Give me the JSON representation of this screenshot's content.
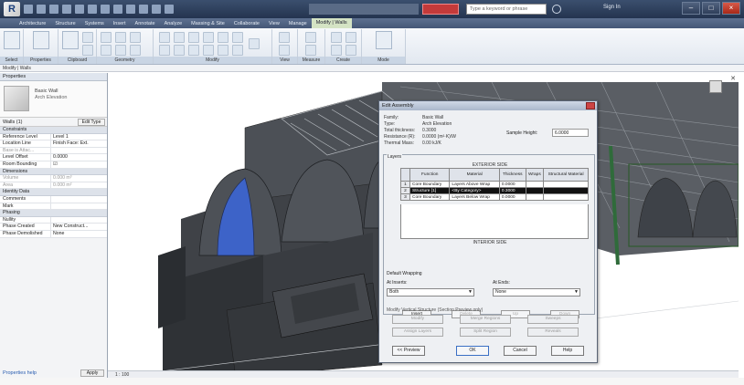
{
  "app": {
    "logo": "R",
    "title": "",
    "search_placeholder": "Type a keyword or phrase",
    "sign_in": "Sign In"
  },
  "ribbon_tabs": [
    {
      "label": "Architecture",
      "active": false
    },
    {
      "label": "Structure",
      "active": false
    },
    {
      "label": "Systems",
      "active": false
    },
    {
      "label": "Insert",
      "active": false
    },
    {
      "label": "Annotate",
      "active": false
    },
    {
      "label": "Analyze",
      "active": false
    },
    {
      "label": "Massing & Site",
      "active": false
    },
    {
      "label": "Collaborate",
      "active": false
    },
    {
      "label": "View",
      "active": false
    },
    {
      "label": "Manage",
      "active": false
    },
    {
      "label": "Modify | Walls",
      "active": true
    }
  ],
  "ribbon_groups": [
    "Select",
    "Properties",
    "Clipboard",
    "Geometry",
    "Modify",
    "View",
    "Measure",
    "Create",
    "Mode",
    "Modify Wall"
  ],
  "command_bar": "Modify | Walls",
  "properties": {
    "title": "Properties",
    "type_name": "Basic Wall",
    "type_sub": "Arch Elevation",
    "instance_label": "Walls (1)",
    "edit_type": "Edit Type",
    "rows": [
      {
        "kind": "cat",
        "label": "Constraints"
      },
      {
        "kind": "row",
        "key": "Reference Level",
        "value": "Level 1"
      },
      {
        "kind": "row",
        "key": "Location Line",
        "value": "Finish Face: Ext."
      },
      {
        "kind": "row",
        "key": "Base is Attac...",
        "value": "",
        "dim": true
      },
      {
        "kind": "row",
        "key": "Level Offset",
        "value": "0.0000"
      },
      {
        "kind": "row",
        "key": "Room Bounding",
        "value": "☑"
      },
      {
        "kind": "cat",
        "label": "Dimensions"
      },
      {
        "kind": "row",
        "key": "Volume",
        "value": "0.000 m³",
        "dim": true
      },
      {
        "kind": "row",
        "key": "Area",
        "value": "0.000 m²",
        "dim": true
      },
      {
        "kind": "cat",
        "label": "Identity Data"
      },
      {
        "kind": "row",
        "key": "Comments",
        "value": ""
      },
      {
        "kind": "row",
        "key": "Mark",
        "value": ""
      },
      {
        "kind": "cat",
        "label": "Phasing"
      },
      {
        "kind": "row",
        "key": "Nullity",
        "value": ""
      },
      {
        "kind": "row",
        "key": "Phase Created",
        "value": "New Construct..."
      },
      {
        "kind": "row",
        "key": "Phase Demolished",
        "value": "None"
      }
    ],
    "help": "Properties help",
    "apply": "Apply"
  },
  "status": "1 : 100",
  "dialog": {
    "title": "Edit Assembly",
    "info": [
      {
        "label": "Family:",
        "value": "Basic Wall"
      },
      {
        "label": "Type:",
        "value": "Arch Elevation"
      },
      {
        "label": "Total thickness:",
        "value": "0.3000"
      },
      {
        "label": "Resistance (R):",
        "value": "0.0000 (m²·K)/W"
      },
      {
        "label": "Thermal Mass:",
        "value": "0.00 kJ/K"
      }
    ],
    "sample_height_label": "Sample Height:",
    "sample_height_value": "6.0000",
    "layers_label": "Layers",
    "exterior_side": "EXTERIOR SIDE",
    "interior_side": "INTERIOR SIDE",
    "columns": [
      "Function",
      "Material",
      "Thickness",
      "Wraps",
      "Structural Material"
    ],
    "layers": [
      {
        "n": "1",
        "function": "Core Boundary",
        "material": "Layers Above Wrap",
        "thickness": "0.0000",
        "selected": false
      },
      {
        "n": "2",
        "function": "Structure [1]",
        "material": "<By Category>",
        "thickness": "0.3000",
        "selected": true
      },
      {
        "n": "3",
        "function": "Core Boundary",
        "material": "Layers Below Wrap",
        "thickness": "0.0000",
        "selected": false
      }
    ],
    "table_buttons": [
      {
        "label": "Insert",
        "disabled": false
      },
      {
        "label": "Delete",
        "disabled": true
      },
      {
        "label": "Up",
        "disabled": true
      },
      {
        "label": "Down",
        "disabled": true
      }
    ],
    "default_wrapping": "Default Wrapping",
    "at_inserts_label": "At Inserts:",
    "at_inserts_value": "Both",
    "at_ends_label": "At Ends:",
    "at_ends_value": "None",
    "modify_vertical": "Modify Vertical Structure (Section Preview only)",
    "modify_buttons": [
      "Modify",
      "Merge Regions",
      "Sweeps",
      "Assign Layers",
      "Split Region",
      "Reveals"
    ],
    "footer_buttons": [
      "<< Preview",
      "OK",
      "Cancel",
      "Help"
    ]
  },
  "colors": {
    "title_bar": "#24344f",
    "ribbon_active_tab": "#d4e3c4",
    "selected_layer": "#111111",
    "wall_glass": "#3d63c8",
    "model_gray": "#4a4d52"
  }
}
